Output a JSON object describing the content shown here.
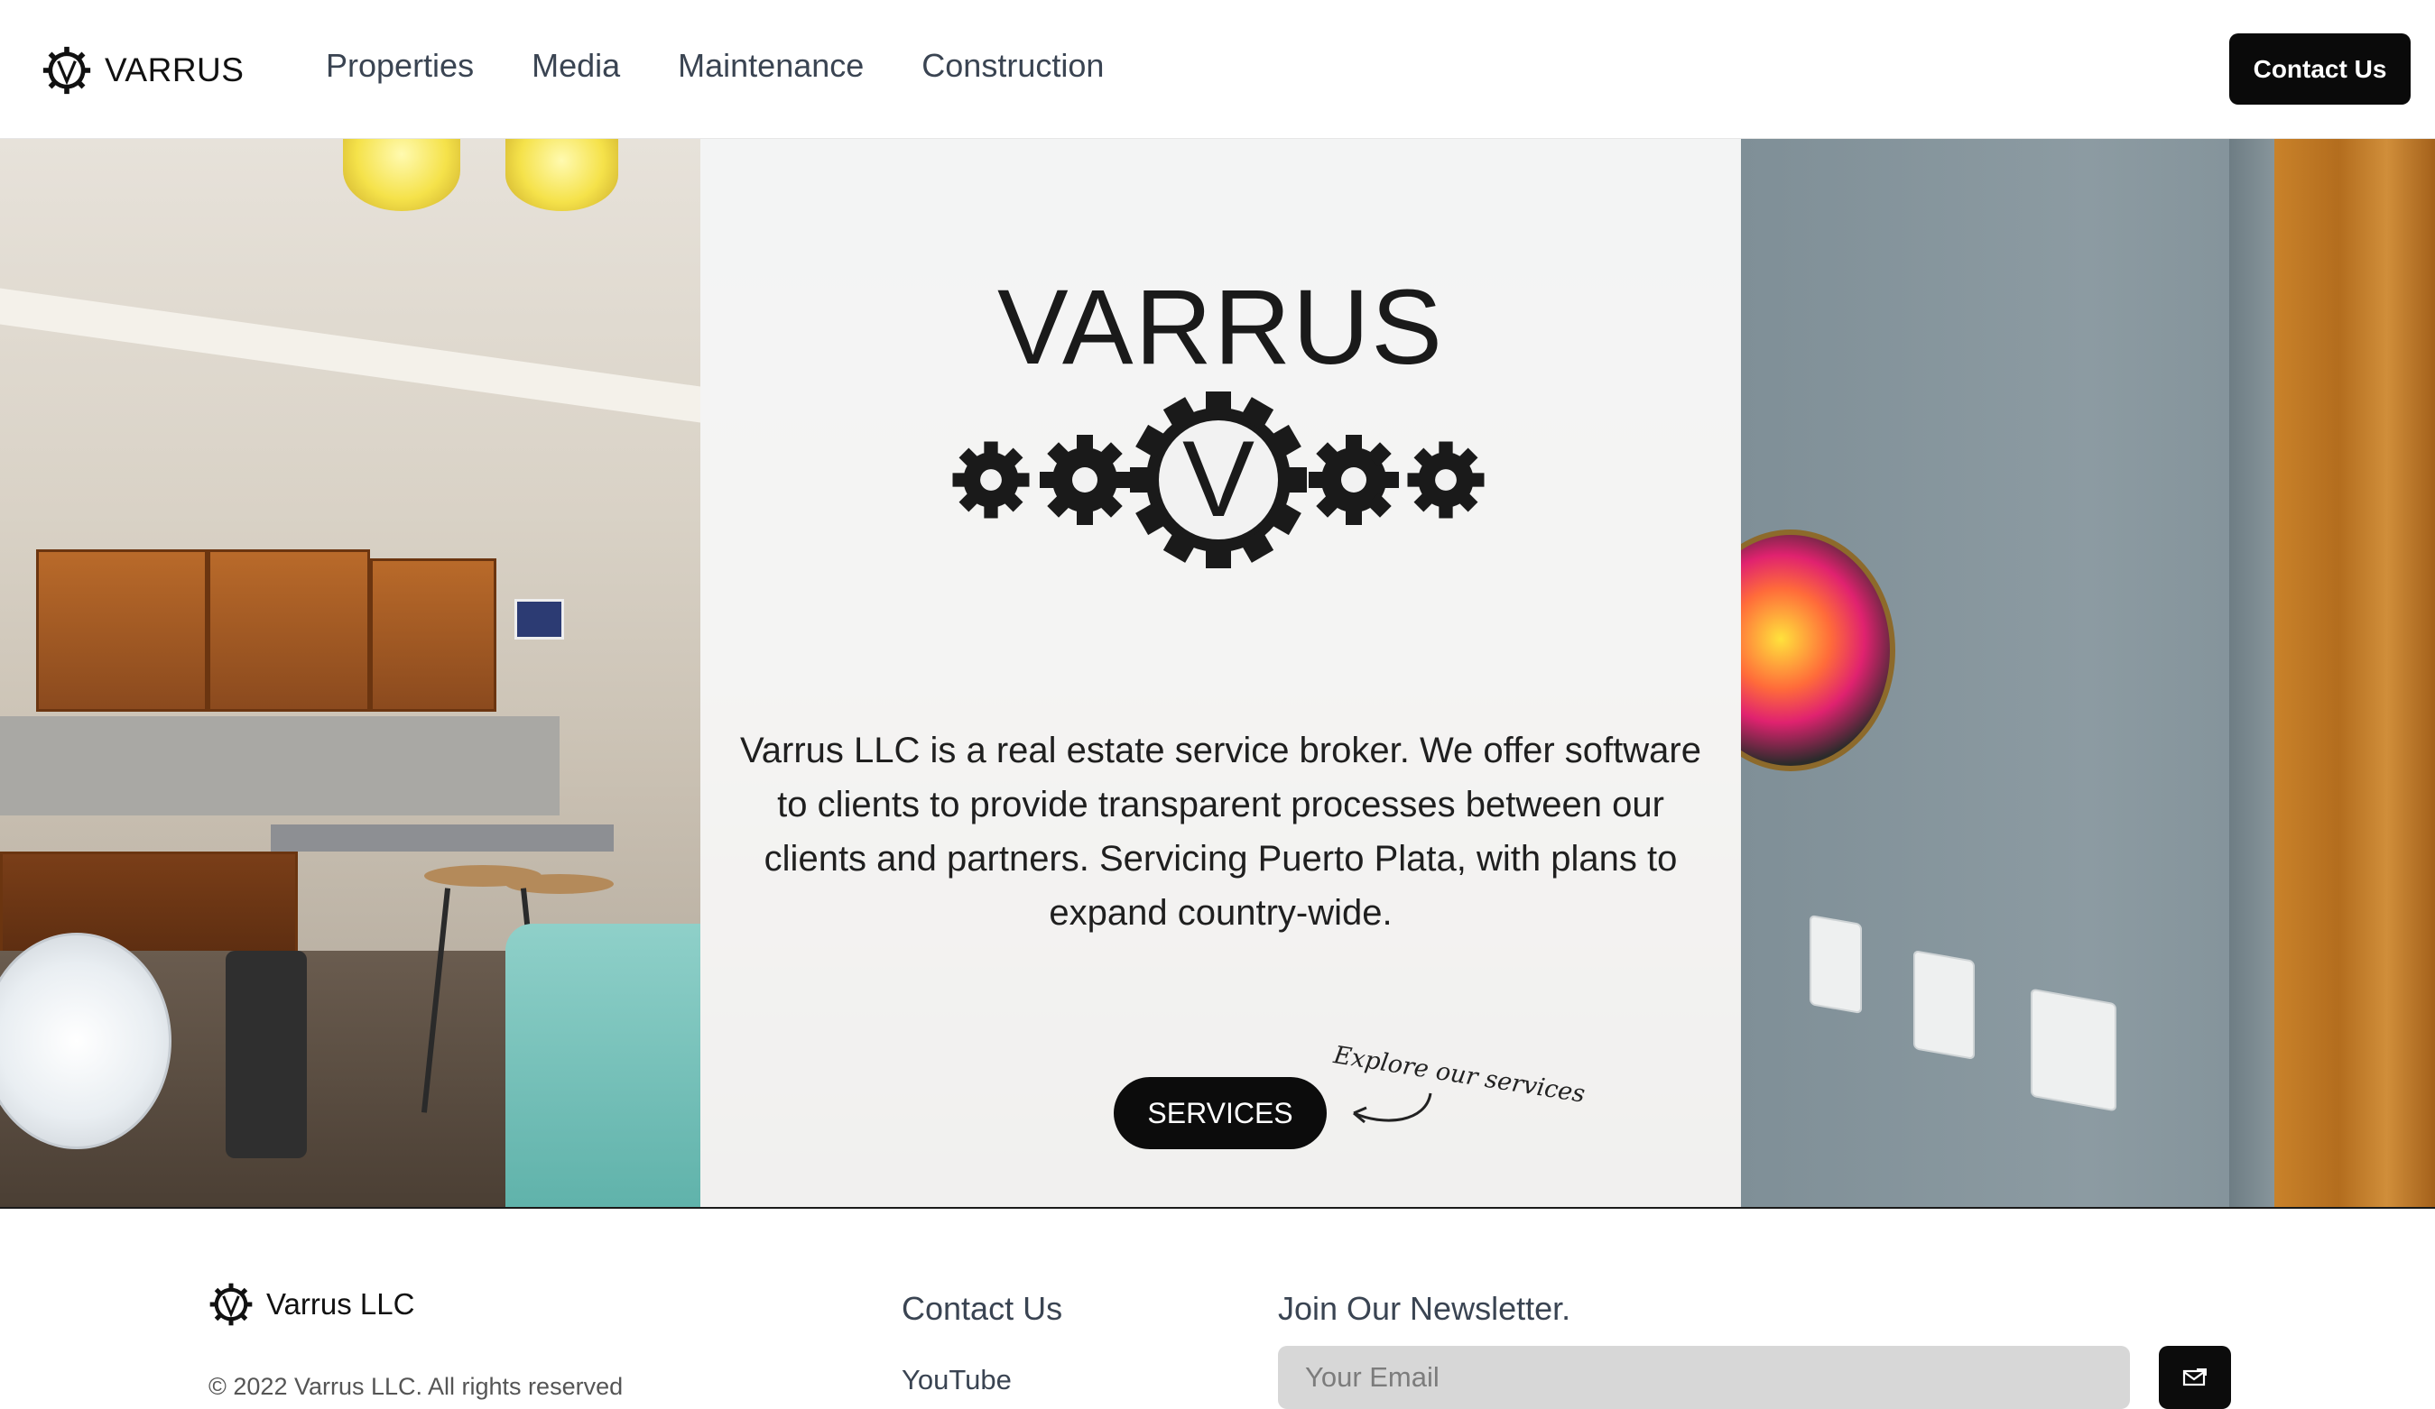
{
  "header": {
    "brand_name": "VARRUS",
    "nav": [
      {
        "label": "Properties"
      },
      {
        "label": "Media"
      },
      {
        "label": "Maintenance"
      },
      {
        "label": "Construction"
      }
    ],
    "contact_button": "Contact Us"
  },
  "hero": {
    "title": "VARRUS",
    "description": "Varrus LLC is a real estate service broker. We offer software to clients to provide transparent processes between our clients and partners. Servicing Puerto Plata, with plans to expand country-wide.",
    "services_button": "SERVICES",
    "explore_note": "Explore our services",
    "logo_letter": "V"
  },
  "footer": {
    "brand_name": "Varrus LLC",
    "copyright": "© 2022 Varrus LLC. All rights reserved",
    "contact": {
      "title": "Contact Us",
      "links": [
        "YouTube"
      ]
    },
    "newsletter": {
      "title": "Join Our Newsletter.",
      "email_placeholder": "Your Email"
    }
  },
  "colors": {
    "primary": "#0a0a0a",
    "nav_text": "#3a4452",
    "panel_bg": "#f4f4f4",
    "input_bg": "#d7d7d7"
  },
  "icons": {
    "brand_logo": "gear-v-icon",
    "hero_logo": "gears-v-icon",
    "submit": "mail-icon",
    "arrow": "curved-arrow-icon"
  }
}
